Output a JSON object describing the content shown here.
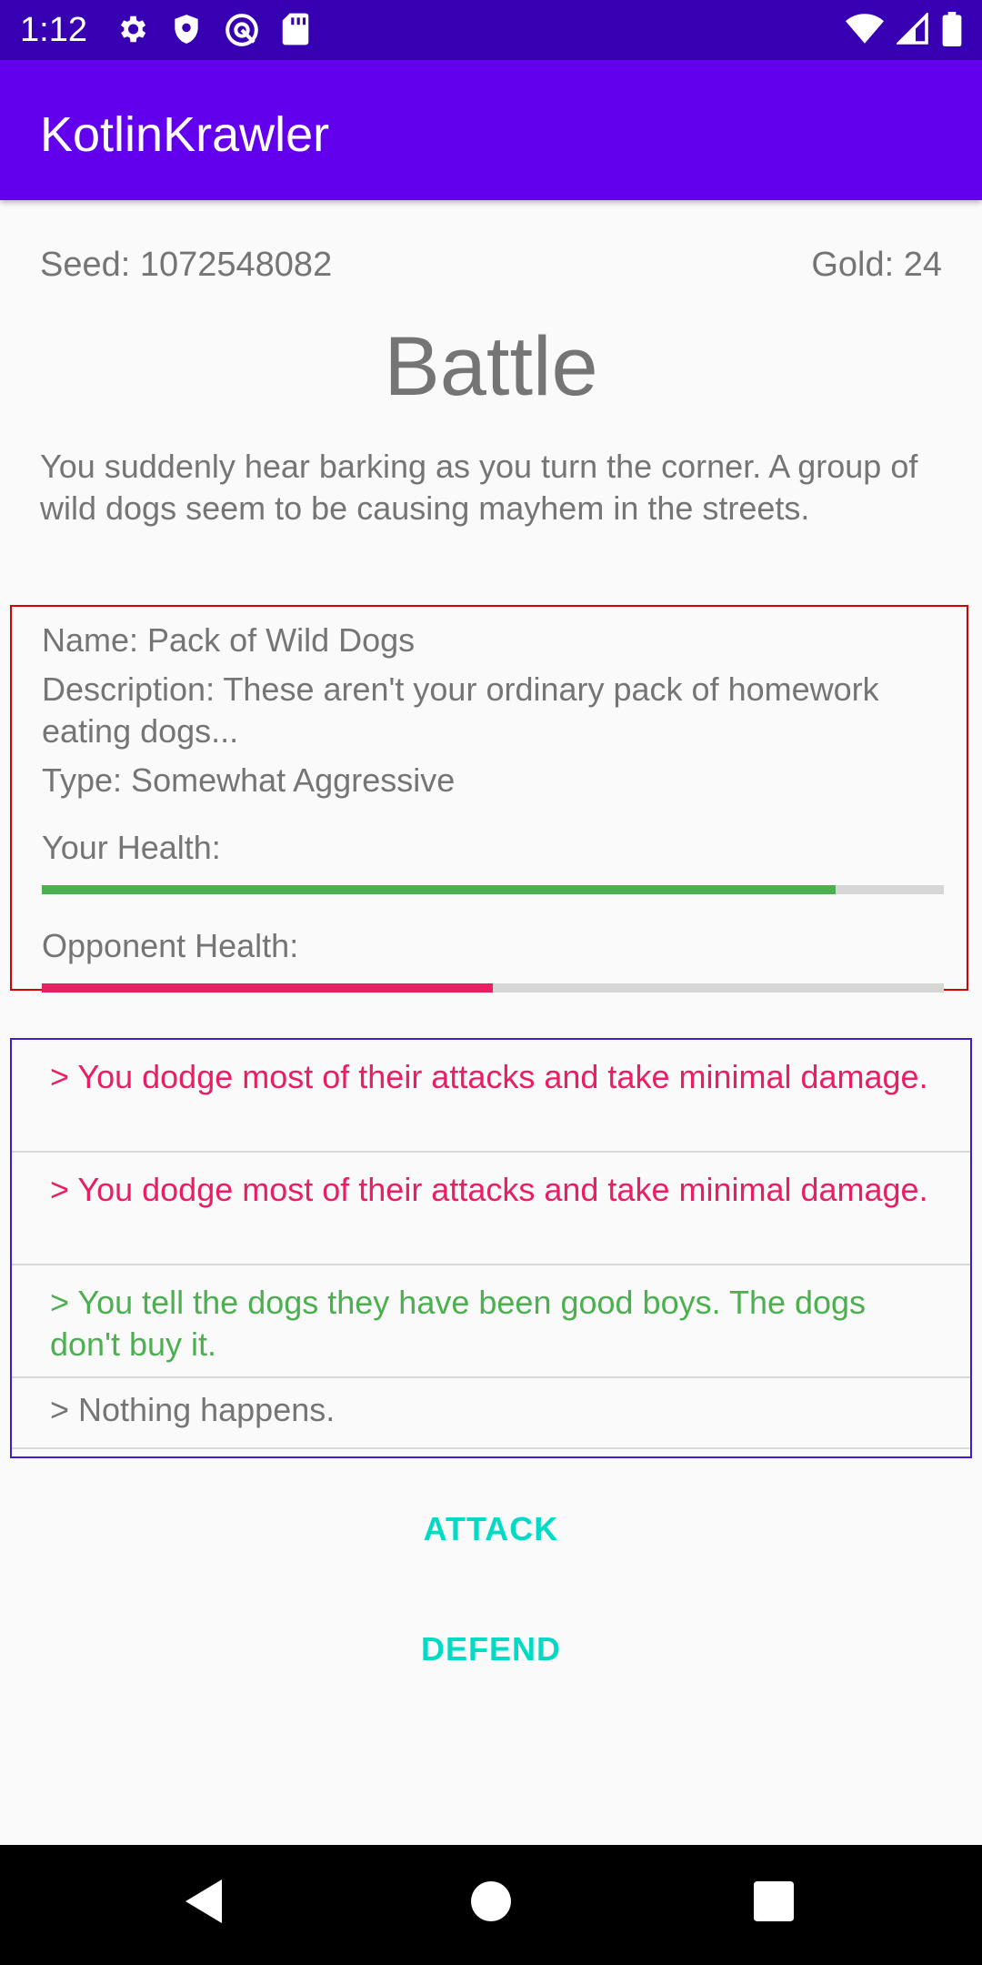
{
  "status_bar": {
    "time": "1:12",
    "left_icons": [
      "gear-icon",
      "shield-icon",
      "at-sign-icon",
      "sd-card-icon"
    ],
    "right_icons": [
      "wifi-icon",
      "cell-signal-icon",
      "battery-icon"
    ]
  },
  "app_bar": {
    "title": "KotlinKrawler"
  },
  "header": {
    "seed": "Seed: 1072548082",
    "gold": "Gold: 24"
  },
  "screen_title": "Battle",
  "intro_text": "You suddenly hear barking as you turn the corner. A group of wild dogs seem to be causing mayhem in the streets.",
  "enemy": {
    "name": "Name: Pack of Wild Dogs",
    "description": "Description: These aren't your ordinary pack of homework eating dogs...",
    "type": "Type: Somewhat Aggressive",
    "your_health_label": "Your Health:",
    "your_health_fraction": 0.88,
    "opponent_health_label": "Opponent Health:",
    "opponent_health_fraction": 0.5
  },
  "battle_log": [
    {
      "text": "> You dodge most of their attacks and take minimal damage.",
      "color": "#e91e63"
    },
    {
      "text": "> You dodge most of their attacks and take minimal damage.",
      "color": "#e91e63"
    },
    {
      "text": "> You tell the dogs they have been good boys. The dogs don't buy it.",
      "color": "#4caf50"
    },
    {
      "text": "> Nothing happens.",
      "color": "#757575"
    }
  ],
  "actions": {
    "attack_label": "ATTACK",
    "defend_label": "DEFEND"
  },
  "colors": {
    "status_bar": "#3700b3",
    "app_bar": "#6200ee",
    "accent": "#03dac5",
    "your_health": "#4caf50",
    "opponent_health": "#e91e63"
  },
  "nav_bar": {
    "icons": [
      "back-icon",
      "home-icon",
      "recents-icon"
    ]
  }
}
